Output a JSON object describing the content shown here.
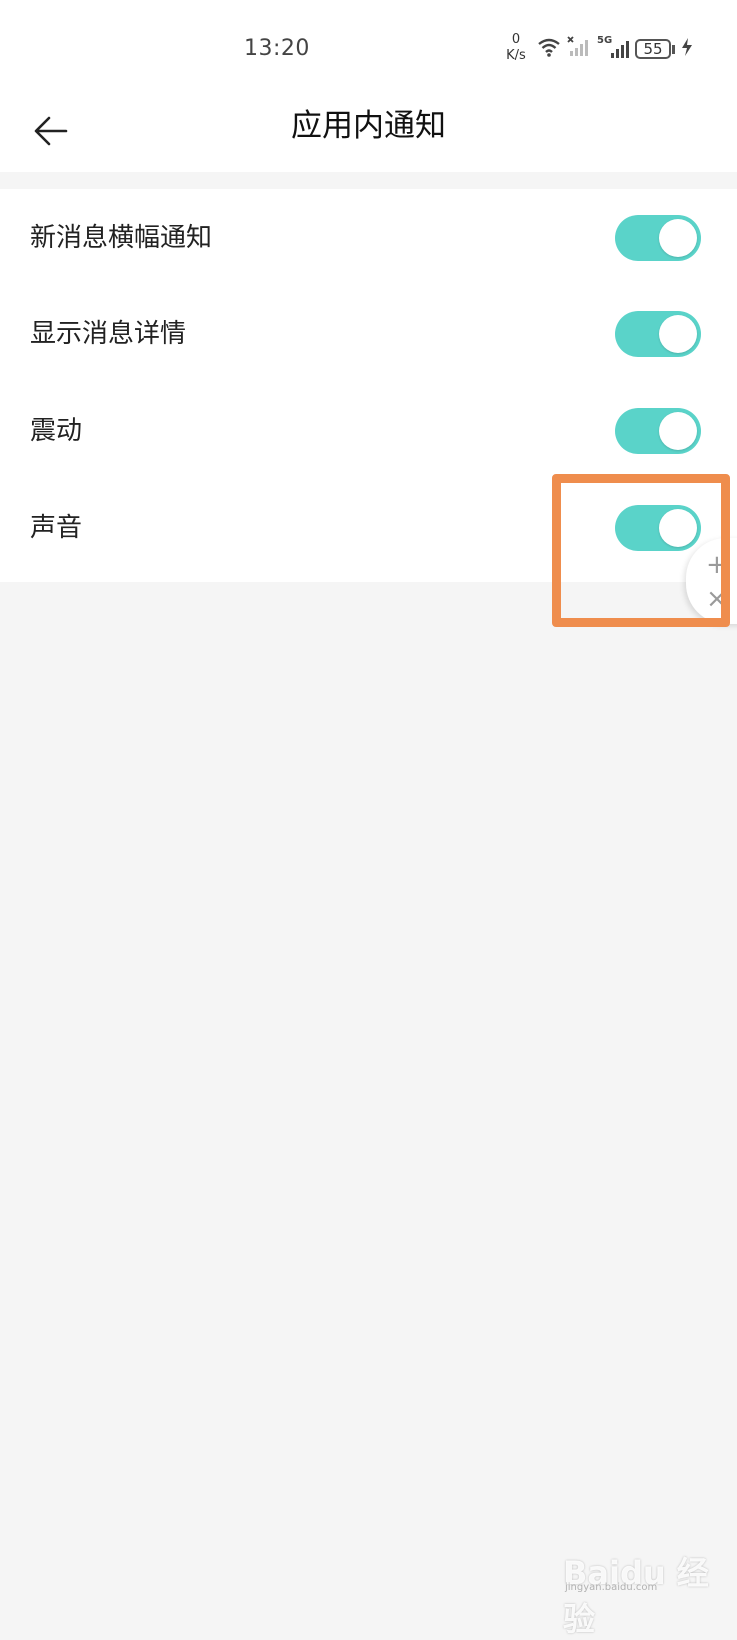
{
  "status_bar": {
    "time": "13:20",
    "net_speed_value": "0",
    "net_speed_unit": "K/s",
    "network_type": "5G",
    "battery": "55"
  },
  "header": {
    "title": "应用内通知",
    "back_icon": "arrow-left-icon"
  },
  "settings": [
    {
      "label": "新消息横幅通知",
      "enabled": true
    },
    {
      "label": "显示消息详情",
      "enabled": true
    },
    {
      "label": "震动",
      "enabled": true
    },
    {
      "label": "声音",
      "enabled": true
    }
  ],
  "float_widget": {
    "plus": "+",
    "close": "×"
  },
  "watermark": {
    "logo": "Baidu 经验",
    "url": "jingyan.baidu.com"
  },
  "colors": {
    "toggle_on": "#5ad3c9",
    "highlight": "#ef8d4d",
    "background": "#f5f5f5"
  }
}
